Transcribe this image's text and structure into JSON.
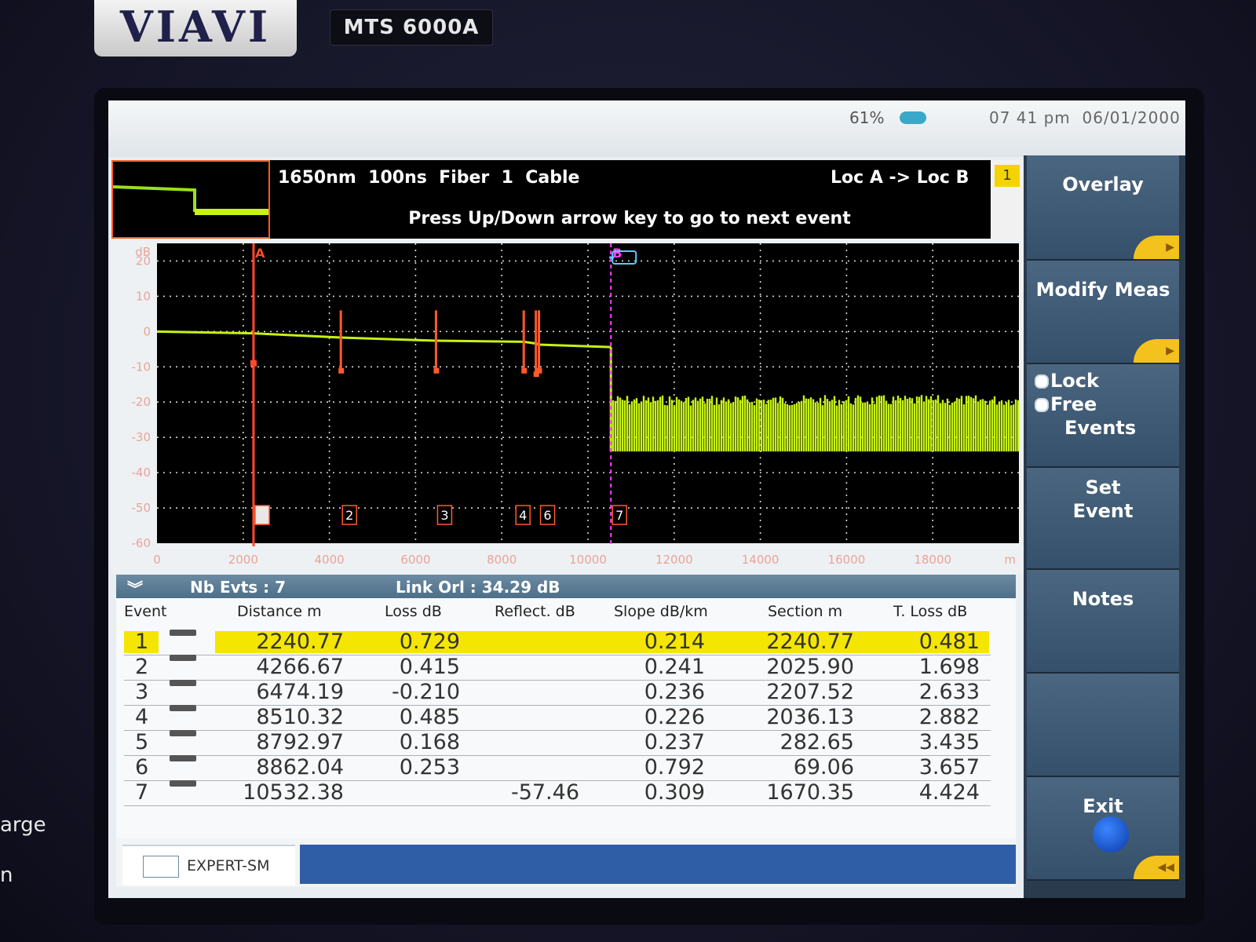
{
  "device": {
    "brand": "VIAVI",
    "model": "MTS 6000A",
    "side_label_1": "arge",
    "side_label_2": "n"
  },
  "status": {
    "battery": "61%",
    "time": "07 41 pm",
    "date": "06/01/2000"
  },
  "header": {
    "wavelength": "1650nm",
    "pulse": "100ns",
    "fiber": "Fiber  1",
    "cable": "Cable",
    "direction": "Loc A -> Loc B",
    "message": "Press Up/Down arrow key to go to next event",
    "badge": "1"
  },
  "softkeys": {
    "overlay": "Overlay",
    "modify": "Modify Meas",
    "lock": "Lock",
    "free": "Free",
    "events": "Events",
    "set_1": "Set",
    "set_2": "Event",
    "notes": "Notes",
    "exit": "Exit"
  },
  "event_bar": {
    "nb_events": "Nb Evts : 7",
    "link_orl": "Link Orl :  34.29 dB"
  },
  "table": {
    "headers": {
      "event": "Event",
      "distance": "Distance  m",
      "loss": "Loss dB",
      "reflect": "Reflect. dB",
      "slope": "Slope  dB/km",
      "section": "Section m",
      "tloss": "T. Loss dB"
    },
    "rows": [
      {
        "n": "1",
        "distance": "2240.77",
        "loss": "0.729",
        "reflect": "",
        "slope": "0.214",
        "section": "2240.77",
        "tloss": "0.481"
      },
      {
        "n": "2",
        "distance": "4266.67",
        "loss": "0.415",
        "reflect": "",
        "slope": "0.241",
        "section": "2025.90",
        "tloss": "1.698"
      },
      {
        "n": "3",
        "distance": "6474.19",
        "loss": "-0.210",
        "reflect": "",
        "slope": "0.236",
        "section": "2207.52",
        "tloss": "2.633"
      },
      {
        "n": "4",
        "distance": "8510.32",
        "loss": "0.485",
        "reflect": "",
        "slope": "0.226",
        "section": "2036.13",
        "tloss": "2.882"
      },
      {
        "n": "5",
        "distance": "8792.97",
        "loss": "0.168",
        "reflect": "",
        "slope": "0.237",
        "section": "282.65",
        "tloss": "3.435"
      },
      {
        "n": "6",
        "distance": "8862.04",
        "loss": "0.253",
        "reflect": "",
        "slope": "0.792",
        "section": "69.06",
        "tloss": "3.657"
      },
      {
        "n": "7",
        "distance": "10532.38",
        "loss": "",
        "reflect": "-57.46",
        "slope": "0.309",
        "section": "1670.35",
        "tloss": "4.424"
      }
    ]
  },
  "footer": {
    "mode": "EXPERT-SM"
  },
  "chart_data": {
    "type": "line",
    "ylabel": "dB",
    "xlabel": "m",
    "xlim": [
      0,
      20000
    ],
    "ylim": [
      -60,
      25
    ],
    "x_ticks": [
      "0",
      "2000",
      "4000",
      "6000",
      "8000",
      "10000",
      "12000",
      "14000",
      "16000",
      "18000"
    ],
    "y_ticks": [
      "20",
      "10",
      "0",
      "-10",
      "-20",
      "-30",
      "-40",
      "-50",
      "-60"
    ],
    "grid": true,
    "series": [
      {
        "x": [
          0,
          2240,
          4266,
          6474,
          8510,
          8792,
          8862,
          10532,
          10540,
          20000
        ],
        "y": [
          0,
          -0.5,
          -1.7,
          -2.6,
          -2.9,
          -3.4,
          -3.7,
          -4.4,
          -30,
          -30
        ]
      }
    ],
    "cursors": [
      {
        "label": "A",
        "x": 2240,
        "color": "#ff4a2a"
      },
      {
        "label": "B",
        "x": 10532,
        "color": "#ff40ff"
      }
    ],
    "events": [
      {
        "label": "1",
        "x": 2240
      },
      {
        "label": "2",
        "x": 4266
      },
      {
        "label": "3",
        "x": 6474
      },
      {
        "label": "4",
        "x": 8510
      },
      {
        "label": "6",
        "x": 8862
      },
      {
        "label": "7",
        "x": 10532
      }
    ],
    "colors": {
      "trace": "#c6f214",
      "event": "#ff5a2a"
    }
  }
}
